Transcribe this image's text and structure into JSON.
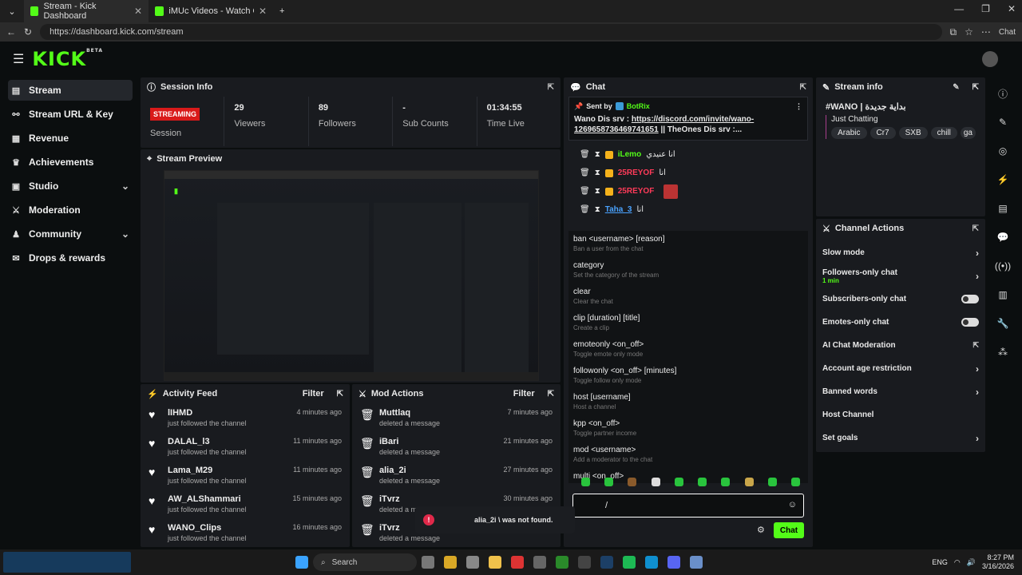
{
  "browser": {
    "tabs": [
      {
        "title": "Stream - Kick Dashboard"
      },
      {
        "title": "iMUc Videos - Watch On-Demand"
      }
    ],
    "url": "https://dashboard.kick.com/stream",
    "copilot_label": "Chat"
  },
  "brand": {
    "logo": "KICK",
    "beta": "BETA",
    "accent": "#53fc18"
  },
  "sidebar": {
    "items": [
      {
        "label": "Stream",
        "icon": "stream-icon"
      },
      {
        "label": "Stream URL & Key",
        "icon": "link-icon"
      },
      {
        "label": "Revenue",
        "icon": "revenue-icon"
      },
      {
        "label": "Achievements",
        "icon": "trophy-icon"
      },
      {
        "label": "Studio",
        "icon": "studio-icon"
      },
      {
        "label": "Moderation",
        "icon": "sword-icon"
      },
      {
        "label": "Community",
        "icon": "people-icon"
      },
      {
        "label": "Drops & rewards",
        "icon": "gift-icon"
      }
    ]
  },
  "session": {
    "title": "Session Info",
    "status": "STREAMING",
    "status_label": "Session",
    "stats": [
      {
        "value": "29",
        "label": "Viewers"
      },
      {
        "value": "89",
        "label": "Followers"
      },
      {
        "value": "-",
        "label": "Sub Counts"
      },
      {
        "value": "01:34:55",
        "label": "Time Live"
      }
    ]
  },
  "preview": {
    "title": "Stream Preview"
  },
  "activity": {
    "title": "Activity Feed",
    "filter": "Filter",
    "rows": [
      {
        "name": "lIHMD",
        "action": "just followed the channel",
        "time": "4 minutes ago"
      },
      {
        "name": "DALAL_l3",
        "action": "just followed the channel",
        "time": "11 minutes ago"
      },
      {
        "name": "Lama_M29",
        "action": "just followed the channel",
        "time": "11 minutes ago"
      },
      {
        "name": "AW_ALShammari",
        "action": "just followed the channel",
        "time": "15 minutes ago"
      },
      {
        "name": "WANO_Clips",
        "action": "just followed the channel",
        "time": "16 minutes ago"
      }
    ]
  },
  "mod": {
    "title": "Mod Actions",
    "filter": "Filter",
    "rows": [
      {
        "name": "Muttlaq",
        "action": "deleted a message",
        "time": "7 minutes ago"
      },
      {
        "name": "iBari",
        "action": "deleted a message",
        "time": "21 minutes ago"
      },
      {
        "name": "alia_2i",
        "action": "deleted a message",
        "time": "27 minutes ago"
      },
      {
        "name": "iTvrz",
        "action": "deleted a message",
        "time": "30 minutes ago"
      },
      {
        "name": "iTvrz",
        "action": "deleted a message",
        "time": ""
      }
    ]
  },
  "chat": {
    "title": "Chat",
    "pinned_by": "Sent by",
    "pinned_user": "BotRix",
    "pinned_text_prefix": "Wano Dis srv : ",
    "pinned_link": "https://discord.com/invite/wano-1269658736469741651",
    "pinned_text_suffix": " || TheOnes Dis srv :...",
    "messages": [
      {
        "user": "iLemo",
        "text": "انا عنيدي"
      },
      {
        "user": "25REYOF",
        "text": "انا"
      },
      {
        "user": "25REYOF",
        "text": ""
      },
      {
        "user": "Taha_3",
        "text": "انا"
      }
    ],
    "commands": [
      {
        "cmd": "ban <username> [reason]",
        "desc": "Ban a user from the chat"
      },
      {
        "cmd": "category",
        "desc": "Set the category of the stream"
      },
      {
        "cmd": "clear",
        "desc": "Clear the chat"
      },
      {
        "cmd": "clip [duration] [title]",
        "desc": "Create a clip"
      },
      {
        "cmd": "emoteonly <on_off>",
        "desc": "Toggle emote only mode"
      },
      {
        "cmd": "followonly <on_off> [minutes]",
        "desc": "Toggle follow only mode"
      },
      {
        "cmd": "host [username]",
        "desc": "Host a channel"
      },
      {
        "cmd": "kpp <on_off>",
        "desc": "Toggle partner income"
      },
      {
        "cmd": "mod <username>",
        "desc": "Add a moderator to the chat"
      },
      {
        "cmd": "multi <on_off>",
        "desc": ""
      }
    ],
    "input_value": "/",
    "send_label": "Chat"
  },
  "toast": {
    "text": "alia_2i \\ was not found."
  },
  "stream_info": {
    "title": "Stream info",
    "stream_title": "#WANO | بداية جديدة",
    "category": "Just Chatting",
    "tags": [
      "Arabic",
      "Cr7",
      "SXB",
      "chill",
      "ga"
    ]
  },
  "channel_actions": {
    "title": "Channel Actions",
    "rows": [
      {
        "label": "Slow mode",
        "sub": "",
        "control": "chevron"
      },
      {
        "label": "Followers-only chat",
        "sub": "1 min",
        "control": "chevron"
      },
      {
        "label": "Subscribers-only chat",
        "sub": "",
        "control": "toggle"
      },
      {
        "label": "Emotes-only chat",
        "sub": "",
        "control": "toggle"
      },
      {
        "label": "AI Chat Moderation",
        "sub": "",
        "control": "external"
      },
      {
        "label": "Account age restriction",
        "sub": "",
        "control": "chevron"
      },
      {
        "label": "Banned words",
        "sub": "",
        "control": "chevron"
      },
      {
        "label": "Host Channel",
        "sub": "",
        "control": "none"
      },
      {
        "label": "Set goals",
        "sub": "",
        "control": "chevron"
      }
    ]
  },
  "taskbar": {
    "search": "Search",
    "lang": "ENG",
    "time": "8:27 PM",
    "date": "3/16/2026"
  }
}
